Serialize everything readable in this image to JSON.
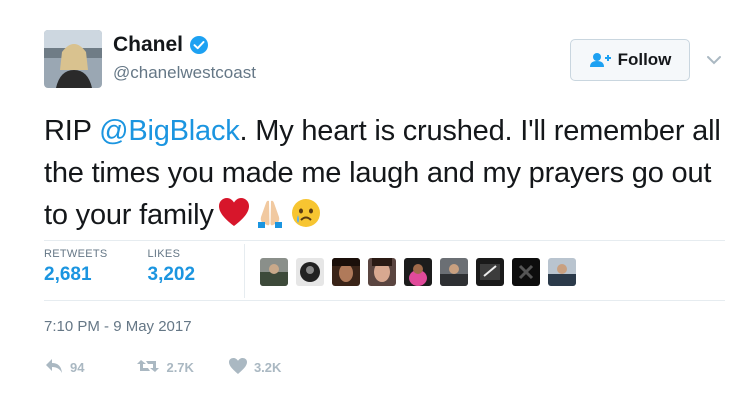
{
  "author": {
    "display_name": "Chanel",
    "handle": "@chanelwestcoast",
    "verified": true
  },
  "follow_button": {
    "label": "Follow",
    "icon": "add-user-icon"
  },
  "tweet": {
    "prefix": "RIP ",
    "mention": "@BigBlack",
    "body": ". My heart is crushed. I'll remember all the times you made me laugh and my prayers go out to your family",
    "emojis": [
      "red-heart-emoji",
      "folded-hands-emoji",
      "crying-face-emoji"
    ]
  },
  "stats": {
    "retweets_label": "RETWEETS",
    "retweets_value": "2,681",
    "likes_label": "LIKES",
    "likes_value": "3,202"
  },
  "timestamp": "7:10 PM - 9 May 2017",
  "actions": {
    "reply_count": "94",
    "retweet_count": "2.7K",
    "like_count": "3.2K"
  },
  "colors": {
    "link": "#1b95e0",
    "muted": "#657786",
    "icon": "#aab8c2",
    "heart": "#e0245e"
  }
}
